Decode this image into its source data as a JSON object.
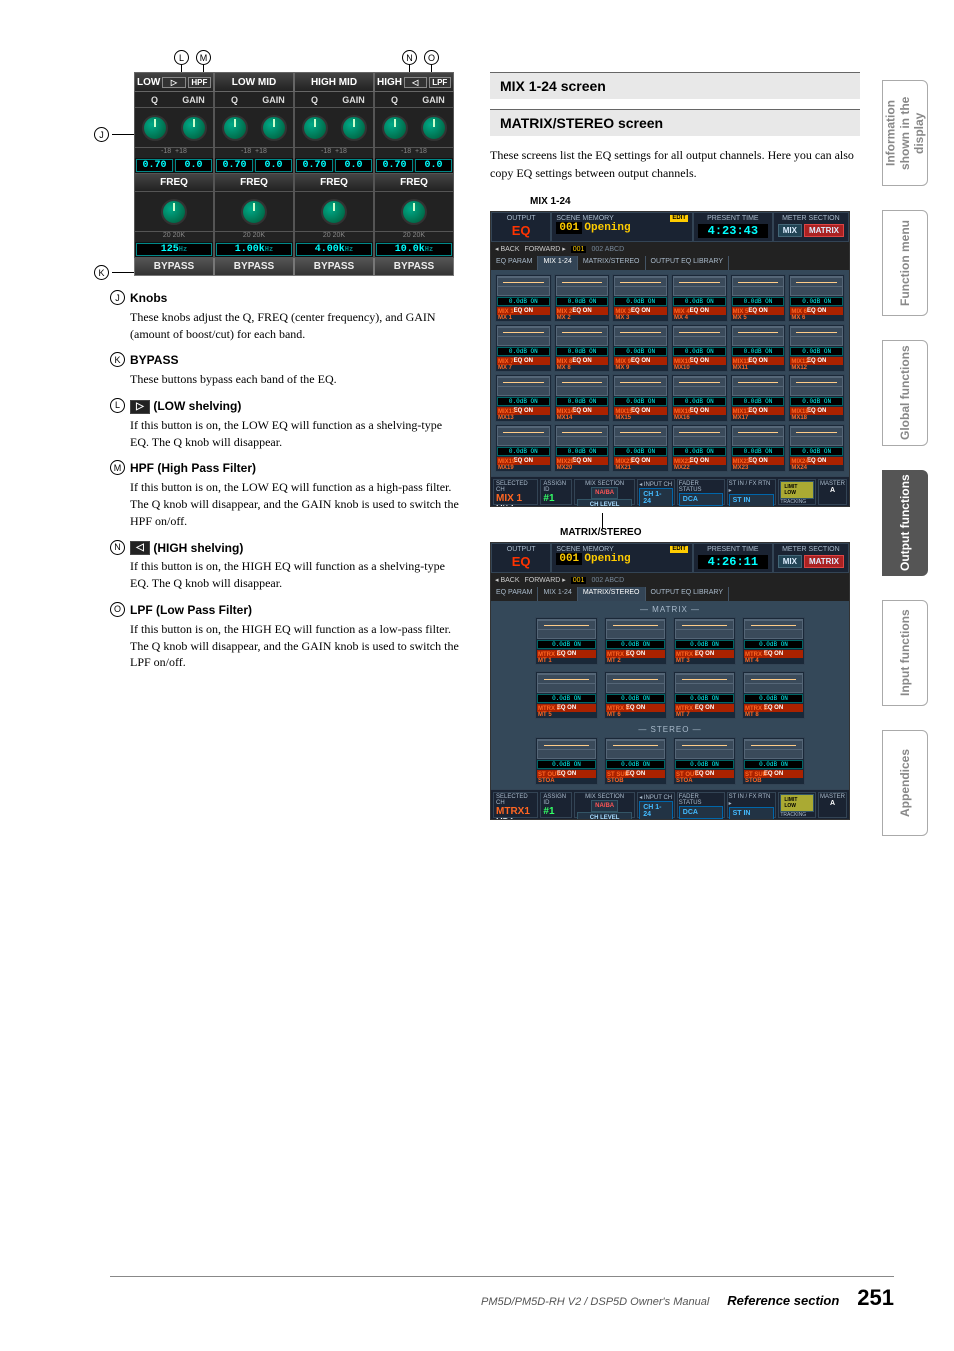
{
  "eq_bands": [
    {
      "label": "LOW",
      "extras": [
        "▷",
        "HPF"
      ],
      "sub": [
        "Q",
        "GAIN"
      ],
      "q": "0.70",
      "gain": "0.0",
      "freq_label": "FREQ",
      "ticks": "20   20K",
      "freq": "125",
      "hz": "Hz",
      "bypass": "BYPASS"
    },
    {
      "label": "LOW MID",
      "sub": [
        "Q",
        "GAIN"
      ],
      "q": "0.70",
      "gain": "0.0",
      "freq_label": "FREQ",
      "ticks": "20   20K",
      "freq": "1.00k",
      "hz": "Hz",
      "bypass": "BYPASS"
    },
    {
      "label": "HIGH MID",
      "sub": [
        "Q",
        "GAIN"
      ],
      "q": "0.70",
      "gain": "0.0",
      "freq_label": "FREQ",
      "ticks": "20   20K",
      "freq": "4.00k",
      "hz": "Hz",
      "bypass": "BYPASS"
    },
    {
      "label": "HIGH",
      "extras": [
        "◁",
        "LPF"
      ],
      "sub": [
        "Q",
        "GAIN"
      ],
      "q": "0.70",
      "gain": "0.0",
      "freq_label": "FREQ",
      "ticks": "20   20K",
      "freq": "10.0k",
      "hz": "Hz",
      "bypass": "BYPASS"
    }
  ],
  "callouts": {
    "c10": "J",
    "c11": "K",
    "c12": "L",
    "c13": "M",
    "c14": "N",
    "c15": "O"
  },
  "descs": [
    {
      "num": "J",
      "title": "Knobs",
      "body": "These knobs adjust the Q, FREQ (center frequency), and GAIN (amount of boost/cut) for each band."
    },
    {
      "num": "K",
      "title": "BYPASS",
      "body": "These buttons bypass each band of the EQ."
    },
    {
      "num": "L",
      "icon": "▷",
      "title_after": " (LOW shelving)",
      "body": "If this button is on, the LOW EQ will function as a shelving-type EQ. The Q knob will disappear."
    },
    {
      "num": "M",
      "title": "HPF (High Pass Filter)",
      "body": "If this button is on, the LOW EQ will function as a high-pass filter. The Q knob will disappear, and the GAIN knob is used to switch the HPF on/off."
    },
    {
      "num": "N",
      "icon": "◁",
      "title_after": " (HIGH shelving)",
      "body": "If this button is on, the HIGH EQ will function as a shelving-type EQ. The Q knob will disappear."
    },
    {
      "num": "O",
      "title": "LPF (Low Pass Filter)",
      "body": "If this button is on, the HIGH EQ will function as a low-pass filter. The Q knob will disappear, and the GAIN knob is used to switch the LPF on/off."
    }
  ],
  "right": {
    "h1": "MIX 1-24 screen",
    "h2": "MATRIX/STEREO screen",
    "intro": "These screens list the EQ settings for all output channels. Here you can also copy EQ settings between output channels.",
    "shot1_label": "MIX 1-24",
    "shot2_label": "MATRIX/STEREO"
  },
  "shot1": {
    "output_label": "OUTPUT",
    "eq": "EQ",
    "scene_label": "SCENE MEMORY",
    "edit": "EDIT",
    "scene_no": "001",
    "scene_name": "Opening",
    "back": "◂ BACK",
    "fwd": "FORWARD ▸",
    "scene_cur": "001",
    "scene_next": "002  ABCD",
    "present_label": "PRESENT TIME",
    "time": "4:23:43",
    "meter_label": "METER SECTION",
    "mix": "MIX",
    "matrix": "MATRIX",
    "tabs": [
      "EQ PARAM",
      "MIX 1-24",
      "MATRIX/STEREO",
      "OUTPUT EQ LIBRARY"
    ],
    "ch_prefix": "MIX",
    "rows": 4,
    "cols": 6,
    "ch_names": [
      "MX 1",
      "MX 2",
      "MX 3",
      "MX 4",
      "MX 5",
      "MX 6",
      "MX 7",
      "MX 8",
      "MX 9",
      "MX10",
      "MX11",
      "MX12",
      "MX13",
      "MX14",
      "MX15",
      "MX16",
      "MX17",
      "MX18",
      "MX19",
      "MX20",
      "MX21",
      "MX22",
      "MX23",
      "MX24"
    ],
    "ch_titles": [
      "MIX 1",
      "MIX 2",
      "MIX 3",
      "MIX 4",
      "MIX 5",
      "MIX 6",
      "MIX 7",
      "MIX 8",
      "MIX 9",
      "MIX10",
      "MIX11",
      "MIX12",
      "MIX13",
      "MIX14",
      "MIX15",
      "MIX16",
      "MIX17",
      "MIX18",
      "MIX19",
      "MIX20",
      "MIX21",
      "MIX22",
      "MIX23",
      "MIX24"
    ],
    "eq_on": "EQ ON",
    "att": "0.0dB  ON",
    "sel_label": "SELECTED CH",
    "sel_id": "MIX 1",
    "sel_sub": "MX  1",
    "assign_label": "ASSIGN ID",
    "assign_id": "#1",
    "mixsend_label": "MIX SECTION",
    "navA": "NA/BA",
    "chLevel": "CH LEVEL",
    "inputch": "◂ INPUT CH",
    "ch124": "CH 1-24",
    "fader": "FADER STATUS",
    "dca": "DCA",
    "stin_label": "ST IN / FX RTN ▸",
    "stin": "ST IN",
    "limit": "LIMIT LOW",
    "track": "TRACKING",
    "ma": "MASTER",
    "a": "A"
  },
  "shot2": {
    "output_label": "OUTPUT",
    "eq": "EQ",
    "scene_label": "SCENE MEMORY",
    "edit": "EDIT",
    "scene_no": "001",
    "scene_name": "Opening",
    "back": "◂ BACK",
    "fwd": "FORWARD ▸",
    "scene_cur": "001",
    "scene_next": "002  ABCD",
    "present_label": "PRESENT TIME",
    "time": "4:26:11",
    "meter_label": "METER SECTION",
    "mix": "MIX",
    "matrix": "MATRIX",
    "tabs": [
      "EQ PARAM",
      "MIX 1-24",
      "MATRIX/STEREO",
      "OUTPUT EQ LIBRARY"
    ],
    "matrix_label": "MATRIX",
    "stereo_label": "STEREO",
    "m_titles": [
      "MTRX 1",
      "MTRX 2",
      "MTRX 3",
      "MTRX 4",
      "MTRX 5",
      "MTRX 6",
      "MTRX 7",
      "MTRX 8"
    ],
    "m_names": [
      "MT 1",
      "MT 2",
      "MT 3",
      "MT 4",
      "MT 5",
      "MT 6",
      "MT 7",
      "MT 8"
    ],
    "s_titles": [
      "ST OUT",
      "ST SUB",
      "ST OUT",
      "ST SUB"
    ],
    "s_names": [
      "STOA",
      "STOB",
      "STOA",
      "STOB"
    ],
    "eq_on": "EQ ON",
    "att": "0.0dB  ON",
    "sel_label": "SELECTED CH",
    "sel_id": "MTRX1",
    "sel_sub": "MT  1",
    "assign_label": "ASSIGN ID",
    "assign_id": "#1",
    "mixsend_label": "MIX SECTION",
    "navA": "NA/BA",
    "chLevel": "CH LEVEL",
    "inputch": "◂ INPUT CH",
    "ch124": "CH 1-24",
    "fader": "FADER STATUS",
    "dca": "DCA",
    "stin_label": "ST IN / FX RTN ▸",
    "stin": "ST IN",
    "limit": "LIMIT LOW",
    "track": "TRACKING",
    "ma": "MASTER",
    "a": "A"
  },
  "side_tabs": [
    {
      "label": "Information shown\nin the display",
      "active": false
    },
    {
      "label": "Function\nmenu",
      "active": false
    },
    {
      "label": "Global\nfunctions",
      "active": false
    },
    {
      "label": "Output\nfunctions",
      "active": true
    },
    {
      "label": "Input\nfunctions",
      "active": false
    },
    {
      "label": "Appendices",
      "active": false
    }
  ],
  "footer": {
    "manual": "PM5D/PM5D-RH V2 / DSP5D Owner's Manual",
    "ref": "Reference section",
    "page": "251"
  }
}
